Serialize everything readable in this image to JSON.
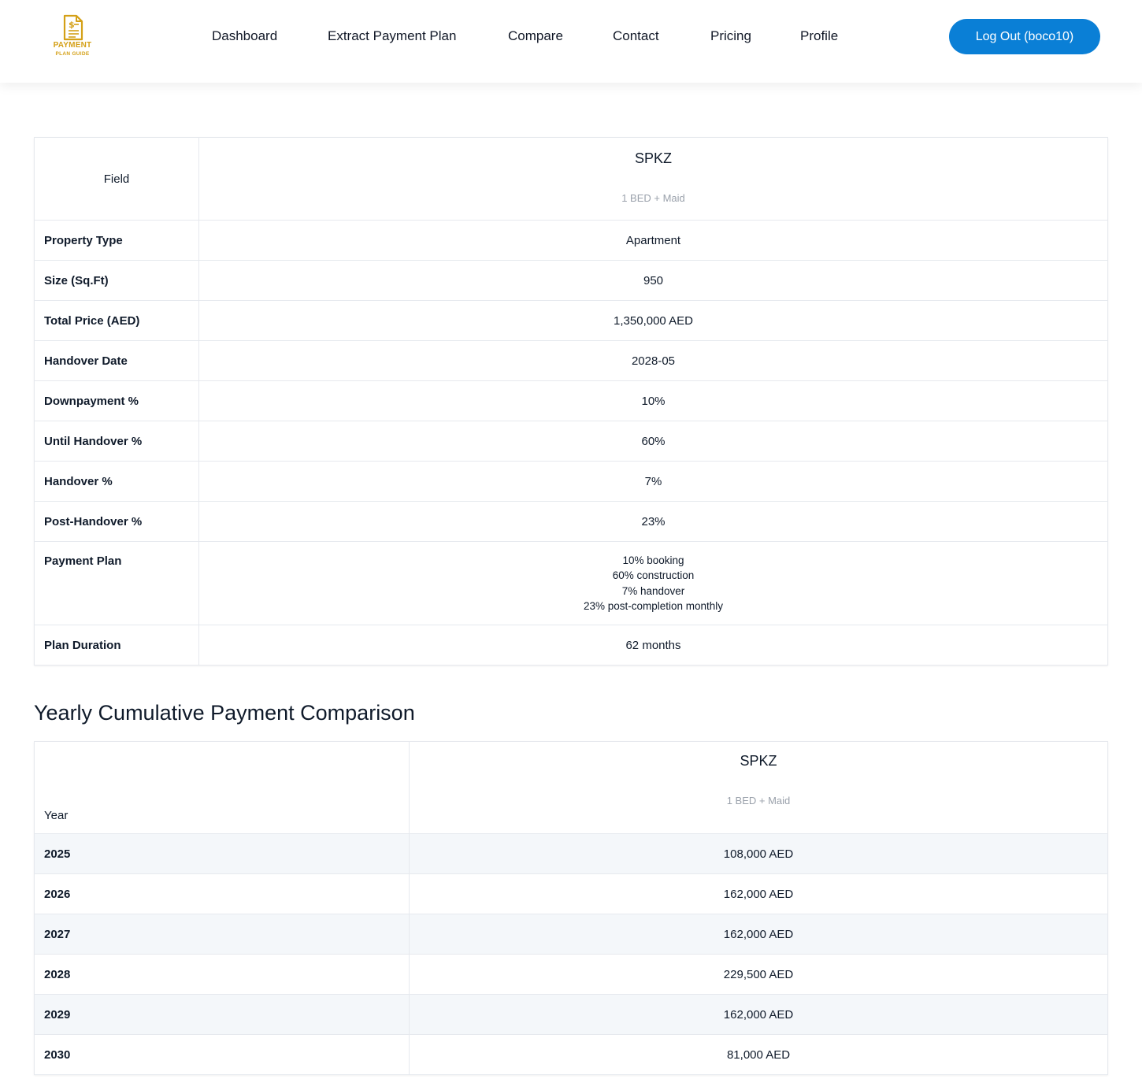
{
  "header": {
    "logo_line1": "PAYMENT",
    "logo_line2": "PLAN GUIDE",
    "nav": [
      "Dashboard",
      "Extract Payment Plan",
      "Compare",
      "Contact",
      "Pricing",
      "Profile"
    ],
    "logout_label": "Log Out (boco10)"
  },
  "comparison": {
    "field_header": "Field",
    "property": {
      "name": "SPKZ",
      "unit": "1 BED + Maid"
    },
    "rows": [
      {
        "label": "Property Type",
        "value": "Apartment"
      },
      {
        "label": "Size (Sq.Ft)",
        "value": "950"
      },
      {
        "label": "Total Price (AED)",
        "value": "1,350,000 AED"
      },
      {
        "label": "Handover Date",
        "value": "2028-05"
      },
      {
        "label": "Downpayment %",
        "value": "10%"
      },
      {
        "label": "Until Handover %",
        "value": "60%"
      },
      {
        "label": "Handover %",
        "value": "7%"
      },
      {
        "label": "Post-Handover %",
        "value": "23%"
      }
    ],
    "payment_plan": {
      "label": "Payment Plan",
      "lines": [
        "10% booking",
        "60% construction",
        "7% handover",
        "23% post-completion monthly"
      ]
    },
    "duration": {
      "label": "Plan Duration",
      "value": "62 months"
    }
  },
  "yearly": {
    "title": "Yearly Cumulative Payment Comparison",
    "year_header": "Year",
    "property": {
      "name": "SPKZ",
      "unit": "1 BED + Maid"
    },
    "rows": [
      {
        "year": "2025",
        "amount": "108,000 AED"
      },
      {
        "year": "2026",
        "amount": "162,000 AED"
      },
      {
        "year": "2027",
        "amount": "162,000 AED"
      },
      {
        "year": "2028",
        "amount": "229,500 AED"
      },
      {
        "year": "2029",
        "amount": "162,000 AED"
      },
      {
        "year": "2030",
        "amount": "81,000 AED"
      }
    ]
  },
  "colors": {
    "accent": "#0a7fd6",
    "logo_gold": "#d4a017",
    "stripe": "#f4f7fa"
  },
  "icons": {
    "logo": "document-dollar-icon"
  }
}
